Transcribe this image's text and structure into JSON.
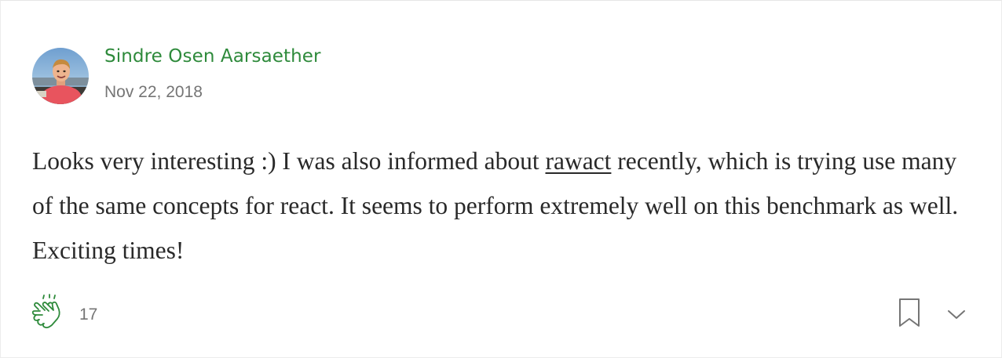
{
  "response": {
    "author": {
      "name": "Sindre Osen Aarsaether",
      "avatar_icon": "user-avatar-photo"
    },
    "date": "Nov 22, 2018",
    "body": {
      "before_link": "Looks very interesting :) I was also informed about ",
      "link_text": "rawact",
      "after_link": " recently, which is trying use many of the same concepts for react. It seems to perform extremely well on this benchmark as well. Exciting times!"
    },
    "actions": {
      "clap_icon": "clap-icon",
      "clap_count": "17",
      "bookmark_icon": "bookmark-icon",
      "more_icon": "chevron-down-icon"
    },
    "colors": {
      "author": "#2e8a3b",
      "clap": "#2e8a3b",
      "text": "#292929",
      "muted": "#757575"
    }
  }
}
